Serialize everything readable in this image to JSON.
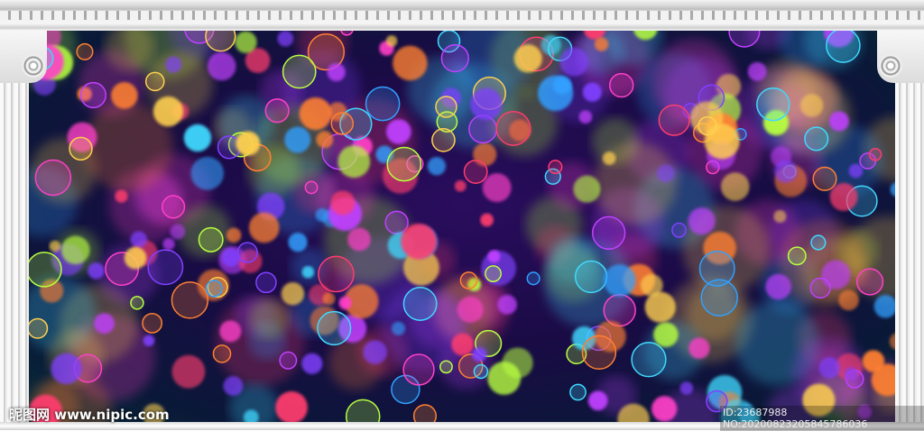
{
  "watermark": {
    "site": "昵图网 www.nipic.com",
    "id_text": "ID:23687988 NO:20200823205845786036"
  },
  "palette": [
    "#ff40c8",
    "#ff3c6e",
    "#c040ff",
    "#40d8ff",
    "#30a0ff",
    "#b8ff40",
    "#ffd050",
    "#ff8030",
    "#8040ff"
  ]
}
